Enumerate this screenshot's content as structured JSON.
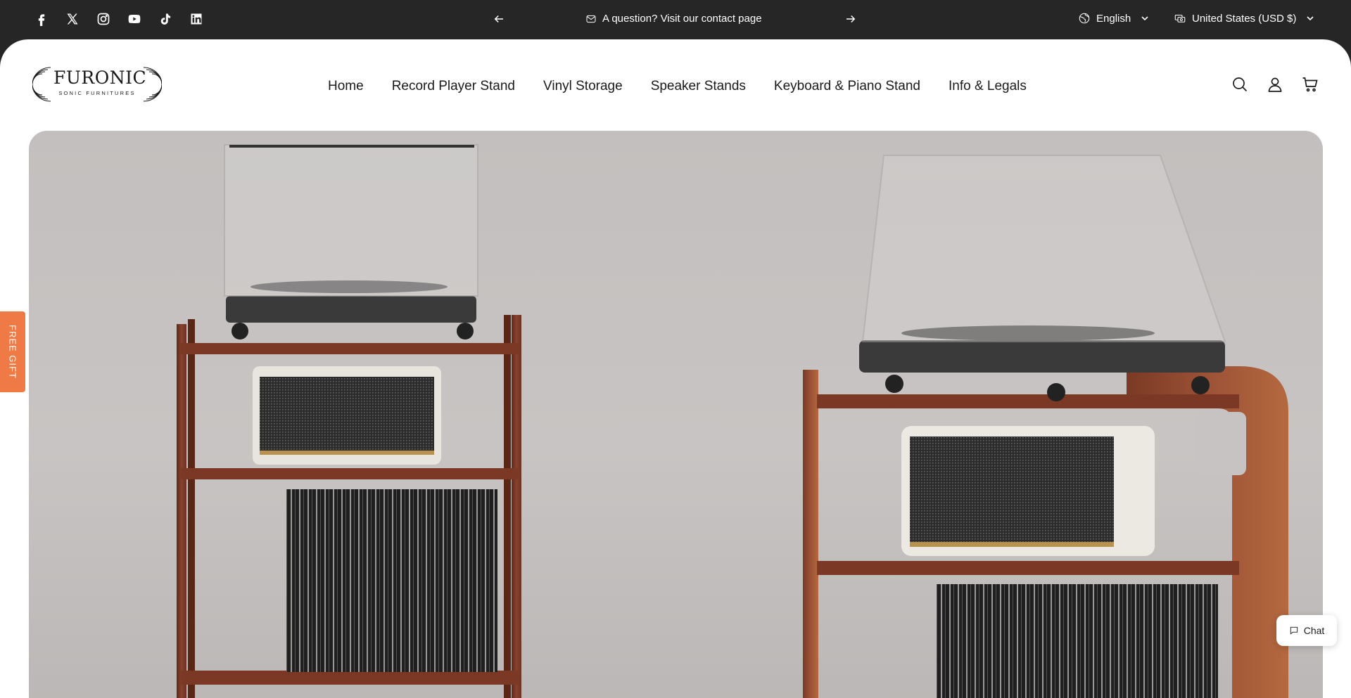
{
  "topbar": {
    "socials": [
      {
        "name": "facebook-icon"
      },
      {
        "name": "x-twitter-icon"
      },
      {
        "name": "instagram-icon"
      },
      {
        "name": "youtube-icon"
      },
      {
        "name": "tiktok-icon"
      },
      {
        "name": "linkedin-icon"
      }
    ],
    "announcement": "A question? Visit our contact page",
    "announcement_icon": "mail-icon",
    "language": "English",
    "currency": "United States (USD $)"
  },
  "header": {
    "logo": {
      "wordmark": "FURONIC",
      "tagline": "SONIC FURNITURES"
    },
    "nav": [
      {
        "label": "Home"
      },
      {
        "label": "Record Player Stand"
      },
      {
        "label": "Vinyl Storage"
      },
      {
        "label": "Speaker Stands"
      },
      {
        "label": "Keyboard & Piano Stand"
      },
      {
        "label": "Info & Legals"
      }
    ],
    "icons": [
      "search-icon",
      "account-icon",
      "cart-icon"
    ]
  },
  "floating": {
    "free_gift": "FREE GIFT",
    "chat": "Chat"
  },
  "colors": {
    "topbar_bg": "#262626",
    "free_gift_bg": "#ef7a45",
    "hero_bg": "#c6c2c1",
    "wood": "#7a3a24"
  }
}
